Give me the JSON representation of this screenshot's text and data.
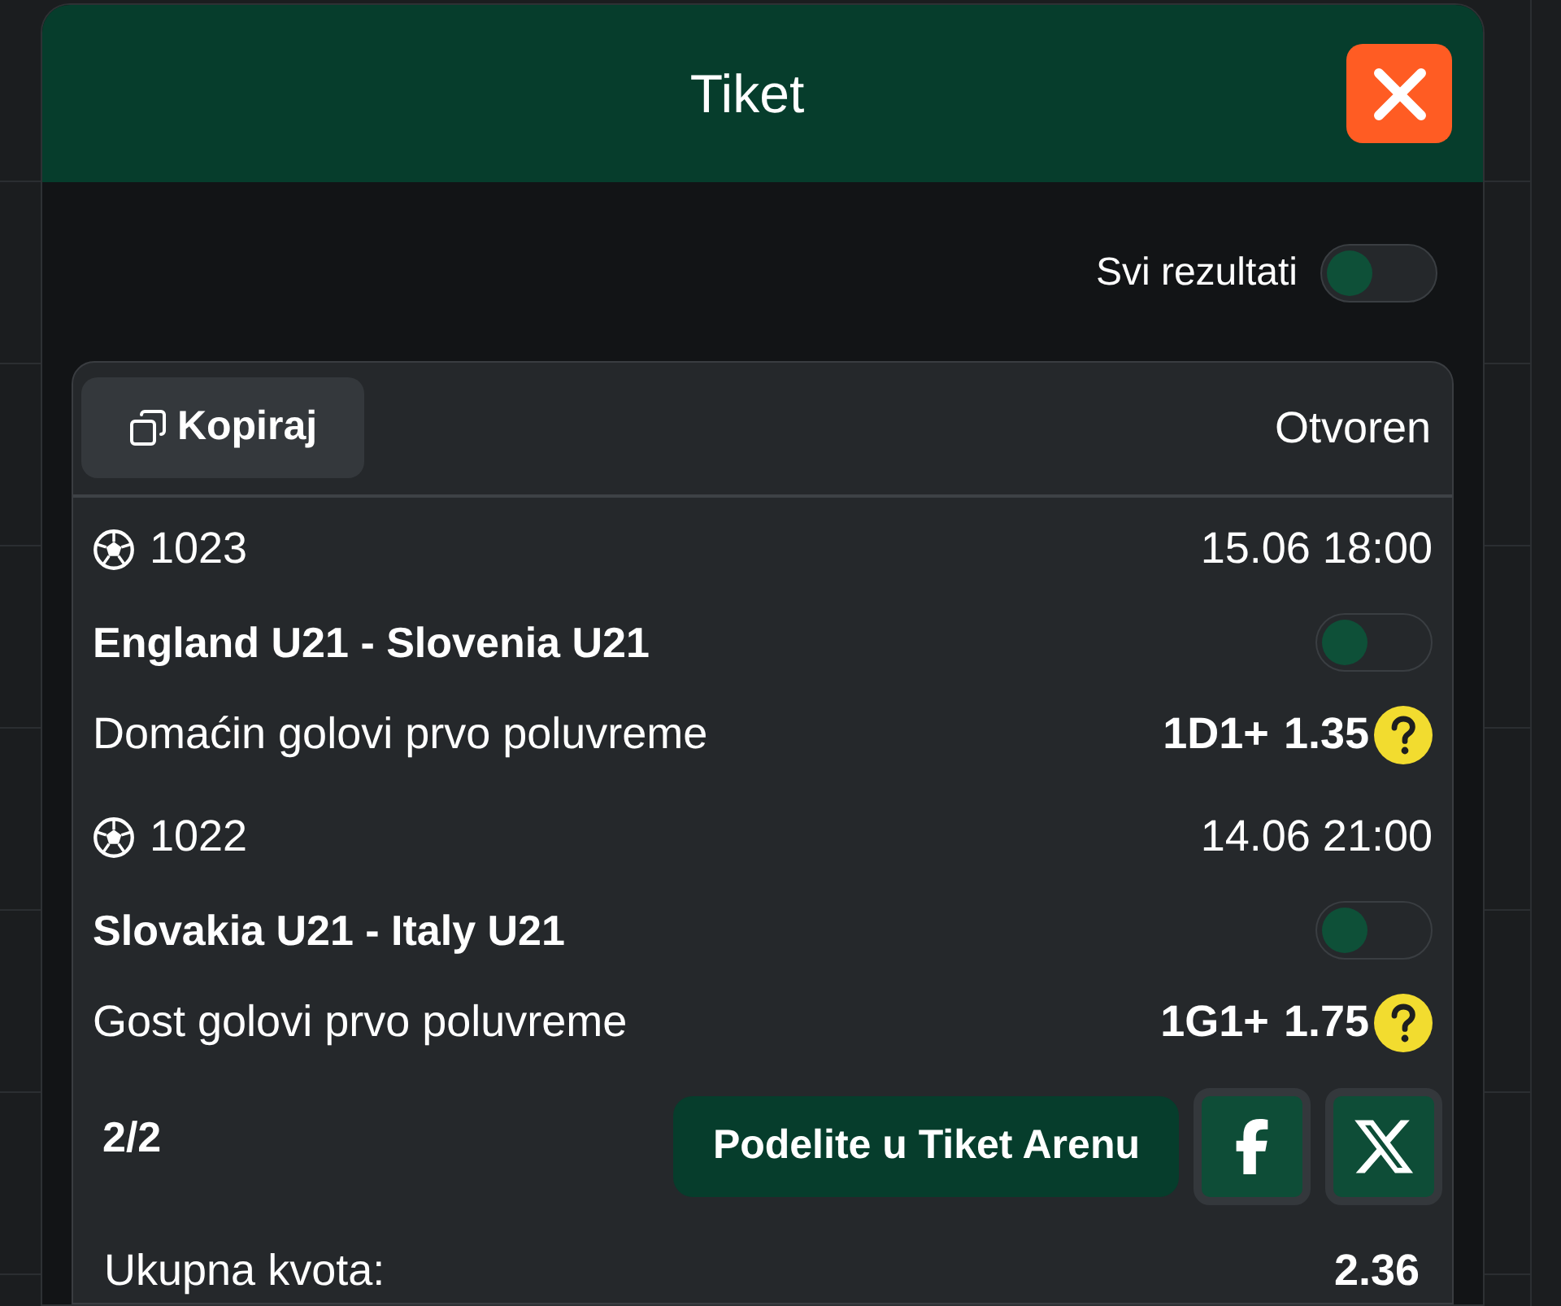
{
  "modal": {
    "title": "Tiket"
  },
  "filter": {
    "label": "Svi rezultati",
    "on": false
  },
  "ticket": {
    "copy_button": "Kopiraj",
    "status": "Otvoren",
    "events": [
      {
        "code": "1023",
        "datetime": "15.06 18:00",
        "match": "England U21 - Slovenia U21",
        "on": false,
        "market": "Domaćin golovi prvo poluvreme",
        "pick": "1D1+",
        "odds": "1.35"
      },
      {
        "code": "1022",
        "datetime": "14.06 21:00",
        "match": "Slovakia U21 - Italy U21",
        "on": false,
        "market": "Gost golovi prvo poluvreme",
        "pick": "1G1+",
        "odds": "1.75"
      }
    ],
    "count": "2/2",
    "share_button": "Podelite u Tiket Arenu",
    "total_label": "Ukupna kvota:",
    "total_odds": "2.36"
  }
}
